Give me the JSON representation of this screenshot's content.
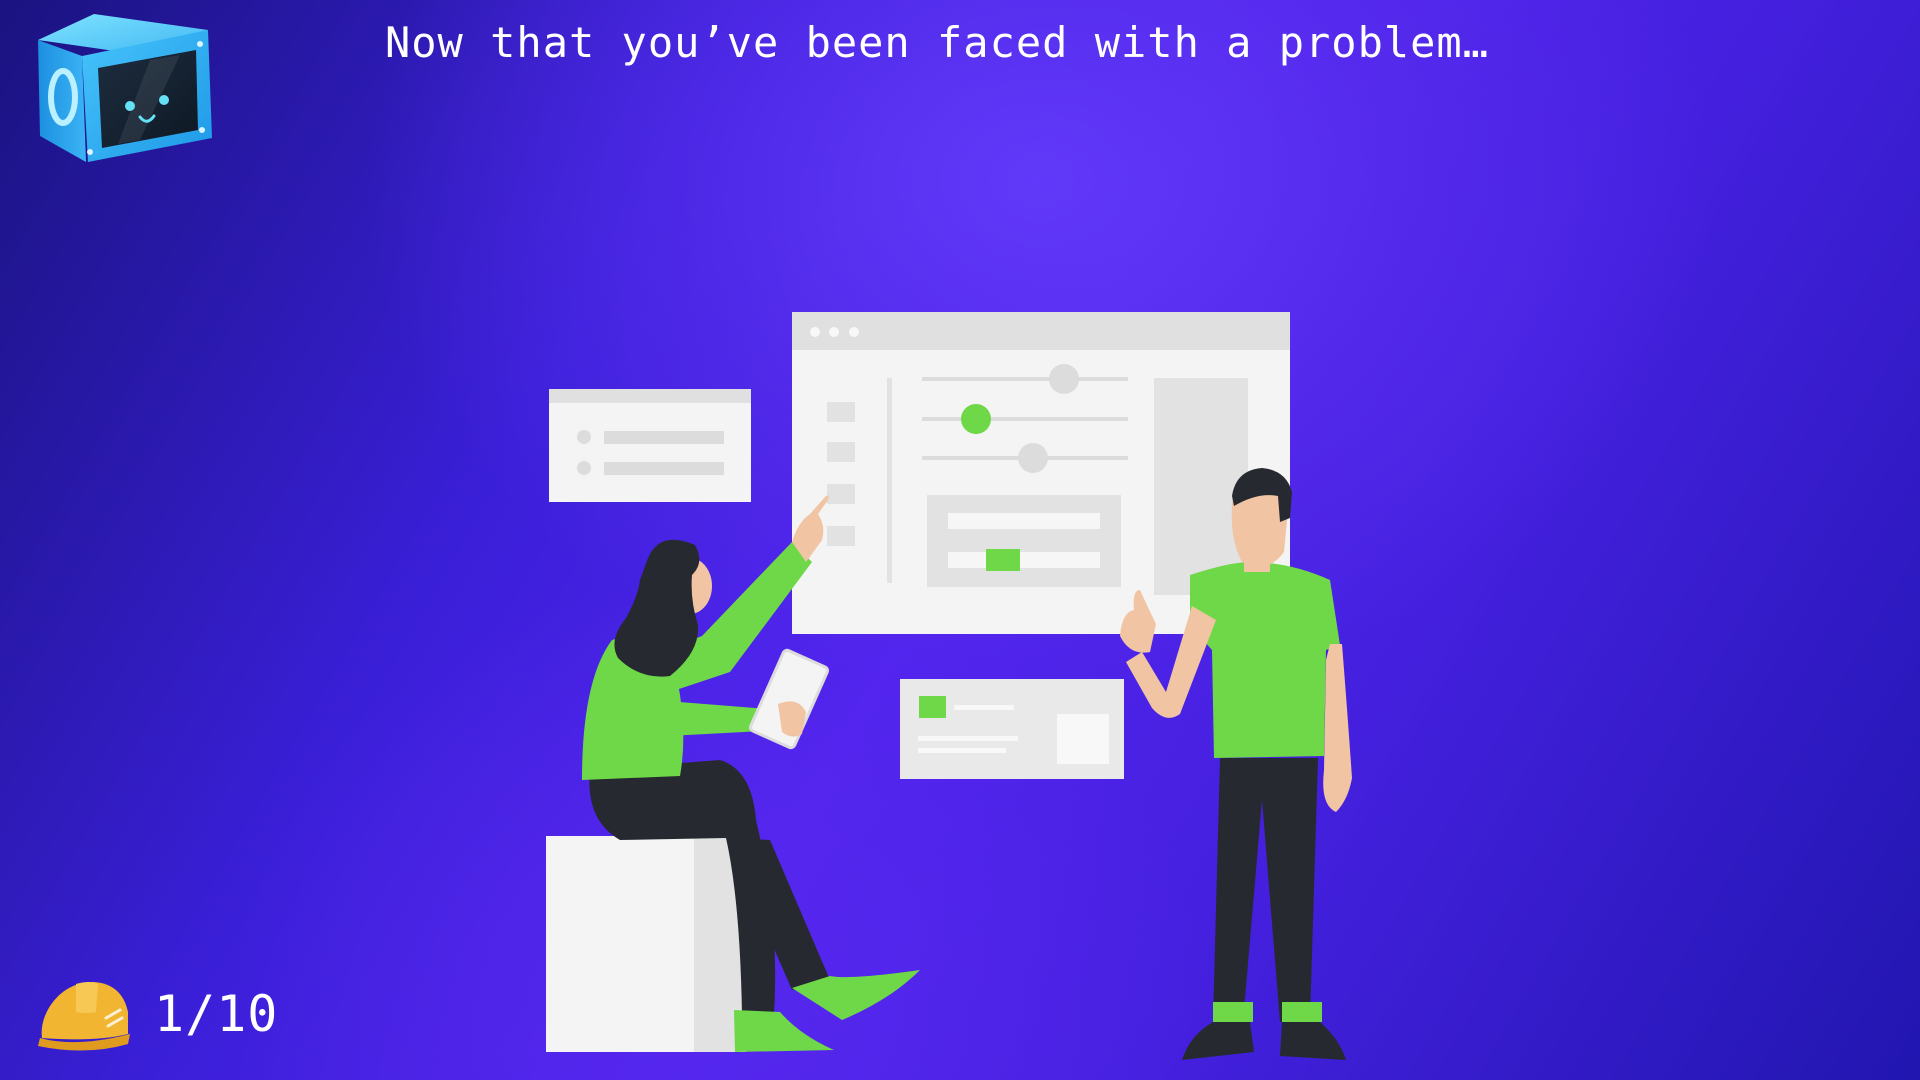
{
  "header": {
    "headline": "Now that you’ve been faced with a problem…",
    "logo_icon": "robot-cube-icon"
  },
  "illustration": {
    "name": "team-discussing-dashboard",
    "accent_color": "#6fd848",
    "panel_color": "#f4f4f4",
    "dark_color": "#262a30",
    "skin_color": "#f1c4a3"
  },
  "progress": {
    "icon": "hard-hat-icon",
    "current": 1,
    "total": 10,
    "label": "1/10"
  }
}
